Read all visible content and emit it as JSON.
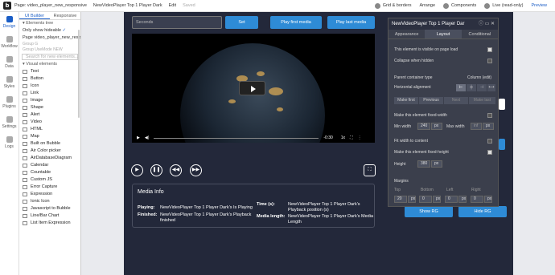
{
  "topbar": {
    "logo": "b",
    "page": "Page: video_player_new_responsive",
    "element": "NewVideoPlayer Top 1 Player Dark",
    "edit": "Edit",
    "saved": "Saved",
    "grid": "Grid & borders",
    "arrange": "Arrange",
    "components": "Components",
    "live": "Live (read-only)",
    "preview": "Preview"
  },
  "leftnav": [
    "Design",
    "Workflow",
    "Data",
    "Styles",
    "Plugins",
    "Settings",
    "Logs"
  ],
  "panel": {
    "tab_ui": "UI Builder",
    "tab_responsive": "Responsive",
    "elements_tree": "Elements tree",
    "only_hideable": "Only show hideable",
    "page_row": "Page video_player_new_resp...",
    "group1": "Group G",
    "group2": "Group UseMode NEW",
    "search": "Search for new elements...",
    "visual_elements": "Visual elements",
    "elements": [
      "Text",
      "Button",
      "Icon",
      "Link",
      "Image",
      "Shape",
      "Alert",
      "Video",
      "HTML",
      "Map",
      "Built on Bubble",
      "Air Color picker",
      "AirDatabaseDiagram",
      "Calendar",
      "Countable",
      "Custom JS",
      "Error Capture",
      "Expression",
      "Ionic Icon",
      "Javascript to Bubble",
      "Line/Bar Chart",
      "List Item Expression"
    ]
  },
  "canvas": {
    "seconds_placeholder": "Seconds",
    "set": "Set",
    "play_first": "Play first media",
    "play_last": "Play last media",
    "time": "-0:30",
    "speed": "1x",
    "media_info_title": "Media Info",
    "playing_label": "Playing:",
    "playing_value": "NewVideoPlayer Top 1 Player Dark's Is Playing",
    "finished_label": "Finished:",
    "finished_value": "NewVideoPlayer Top 1 Player Dark's Playback finished",
    "time_label": "Time (s):",
    "time_value": "NewVideoPlayer Top 1 Player Dark's Playback position (s)",
    "length_label": "Media length:",
    "length_value": "NewVideoPlayer Top 1 Player Dark's Media Length",
    "show_rg": "Show RG",
    "hide_rg": "Hide RG"
  },
  "props": {
    "title": "NewVideoPlayer Top 1 Player Dar",
    "tab_appearance": "Appearance",
    "tab_layout": "Layout",
    "tab_conditional": "Conditional",
    "visible_on_load": "This element is visible on page load",
    "collapse_hidden": "Collapse when hidden",
    "parent_type_label": "Parent container type",
    "parent_type_value": "Column (edit)",
    "horizontal_alignment": "Horizontal alignment",
    "make_first": "Make first",
    "previous": "Previous",
    "next": "Next",
    "make_last": "Make last",
    "fixed_width": "Make this element fixed-width",
    "min_width_label": "Min width",
    "min_width_value": "240",
    "px": "px",
    "max_width_label": "Max width",
    "inf": "inf",
    "fit_width": "Fit width to content",
    "fixed_height": "Make this element fixed-height",
    "height_label": "Height",
    "height_value": "380",
    "margins": "Margins",
    "top": "Top",
    "bottom": "Bottom",
    "left": "Left",
    "right": "Right",
    "margin_top": "20",
    "margin_bottom": "0",
    "margin_left": "0",
    "margin_right": "0"
  }
}
